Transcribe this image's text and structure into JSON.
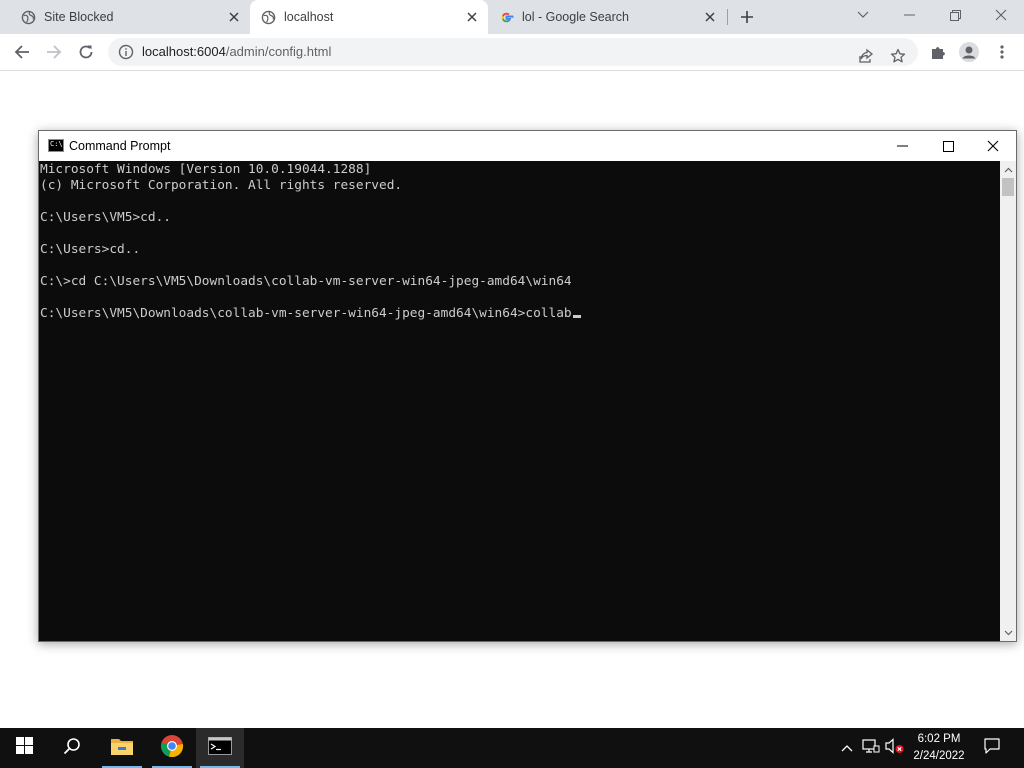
{
  "browser": {
    "tabs": [
      {
        "label": "Site Blocked",
        "icon": "globe-icon",
        "active": false
      },
      {
        "label": "localhost",
        "icon": "globe-icon",
        "active": true
      },
      {
        "label": "lol - Google Search",
        "icon": "google-icon",
        "active": false
      }
    ],
    "address": {
      "host": "localhost:6004",
      "path": "/admin/config.html"
    }
  },
  "cmd_window": {
    "title": "Command Prompt",
    "lines": [
      "Microsoft Windows [Version 10.0.19044.1288]",
      "(c) Microsoft Corporation. All rights reserved.",
      "",
      "C:\\Users\\VM5>cd..",
      "",
      "C:\\Users>cd..",
      "",
      "C:\\>cd C:\\Users\\VM5\\Downloads\\collab-vm-server-win64-jpeg-amd64\\win64",
      ""
    ],
    "prompt": "C:\\Users\\VM5\\Downloads\\collab-vm-server-win64-jpeg-amd64\\win64>",
    "input": "collab"
  },
  "taskbar": {
    "pinned": [
      "windows-start-icon",
      "search-icon",
      "file-explorer-icon",
      "chrome-icon",
      "command-prompt-icon"
    ],
    "clock": {
      "time": "6:02 PM",
      "date": "2/24/2022"
    }
  },
  "colors": {
    "console_bg": "#0c0c0c",
    "console_text": "#cccccc",
    "taskbar_bg": "#101010",
    "tabstrip_bg": "#dee1e6"
  }
}
